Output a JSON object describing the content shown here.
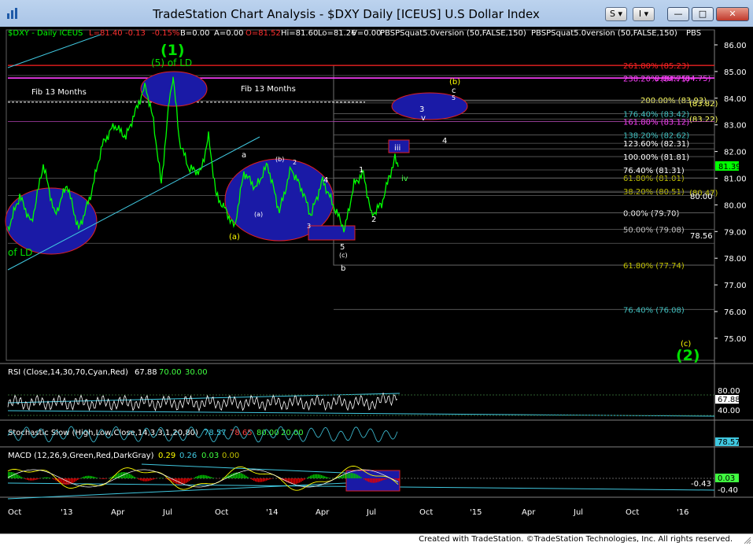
{
  "window": {
    "title": "TradeStation Chart Analysis - $DXY Daily [ICEUS] U.S Dollar Index",
    "dropdown_s": "S",
    "dropdown_i": "I",
    "minimize_label": "—",
    "maximize_label": "□",
    "close_label": "✕"
  },
  "footer": {
    "credit": "Created with TradeStation. ©TradeStation Technologies, Inc. All rights reserved."
  },
  "colors": {
    "background": "#000000",
    "price": "#00ff00",
    "fib_red": "#ff0000",
    "fib_magenta": "#ff00ff",
    "ellipse_fill": "#1a1aa6",
    "trendline": "#40c8e0",
    "wave_label": "#ffff00"
  },
  "header": {
    "symbol": "$DXY - Daily  ICEUS",
    "last": "L=81.40",
    "net": "-0.13",
    "pct": "-0.15%",
    "bid": "B=0.00",
    "ask": "A=0.00",
    "open": "O=81.52",
    "hi": "Hi=81.60",
    "lo": "Lo=81.26",
    "v": "V=0.00",
    "study1": "PBSPSquat5.0version (50,FALSE,150)",
    "study2": "PBSPSquat5.0version (50,FALSE,150)",
    "pbs": "PBS"
  },
  "price_axis": [
    "86.00",
    "85.00",
    "84.00",
    "83.00",
    "82.00",
    "81.00",
    "80.00",
    "79.00",
    "78.00",
    "77.00",
    "76.00",
    "75.00"
  ],
  "last_price_tag": "81.39",
  "price_tags": [
    "80.00",
    "78.56"
  ],
  "fib_levels": [
    {
      "label": "261.80% (85.23)",
      "price": 85.23,
      "color": "#ff2020"
    },
    {
      "label": "238.20% (84.75)",
      "price": 84.75,
      "color": "#ff40ff"
    },
    {
      "label": "0.00% (84.75)",
      "price": 84.76,
      "color": "#ff40ff"
    },
    {
      "label": "200.00% (83.93)",
      "price": 83.93,
      "color": "#ffff60"
    },
    {
      "label": "(83.82)",
      "price": 83.82,
      "color": "#ffff60"
    },
    {
      "label": "176.40% (83.42)",
      "price": 83.42,
      "color": "#40c0c0"
    },
    {
      "label": "161.80% (83.12)",
      "price": 83.12,
      "color": "#ff40ff"
    },
    {
      "label": "(83.22)",
      "price": 83.22,
      "color": "#ffff60"
    },
    {
      "label": "138.20% (82.62)",
      "price": 82.62,
      "color": "#40c0c0"
    },
    {
      "label": "123.60% (82.31)",
      "price": 82.31,
      "color": "#ffffff"
    },
    {
      "label": "100.00% (81.81)",
      "price": 81.81,
      "color": "#ffffff"
    },
    {
      "label": "76.40% (81.31)",
      "price": 81.31,
      "color": "#ffffff"
    },
    {
      "label": "61.80% (81.01)",
      "price": 81.01,
      "color": "#c0c000"
    },
    {
      "label": "38.20% (80.51)",
      "price": 80.51,
      "color": "#c0c000"
    },
    {
      "label": "(80.47)",
      "price": 80.47,
      "color": "#c0c000"
    },
    {
      "label": "0.00% (79.70)",
      "price": 79.7,
      "color": "#ffffff"
    },
    {
      "label": "50.00% (79.08)",
      "price": 79.08,
      "color": "#c0c0c0"
    },
    {
      "label": "61.80% (77.74)",
      "price": 77.74,
      "color": "#c0c000"
    },
    {
      "label": "76.40% (76.08)",
      "price": 76.08,
      "color": "#40c0c0"
    }
  ],
  "wave_labels": {
    "w1": "(1)",
    "w5_of_ld": "(5) of LD",
    "of_ld": "of LD",
    "fib13a": "Fib 13 Months",
    "fib13b": "Fib 13 Months",
    "a": "a",
    "b": "b",
    "wa": "(a)",
    "wa2": "(a)",
    "wb": "(b)",
    "wb_top": "(b)",
    "w2_small": "2",
    "w3_small": "3",
    "w4_small": "4",
    "w5_small": "5",
    "wc": "(c)",
    "n1": "1",
    "n2": "2",
    "n3": "3",
    "n4": "4",
    "iii": "iii",
    "iv": "iv",
    "v": "v",
    "c": "c",
    "c5": "5",
    "wc2": "(c)",
    "w2_big": "(2)"
  },
  "rsi": {
    "label": "RSI (Close,14,30,70,Cyan,Red)",
    "value": "67.88",
    "ob": "70.00",
    "os": "30.00",
    "axis_hi": "80.00",
    "axis_lo": "40.00",
    "tag": "67.88"
  },
  "stoch": {
    "label": "Stochastic Slow (High,Low,Close,14,3,3,1,20,80)",
    "k": "78.57",
    "d": "78.65",
    "ob": "80.00",
    "os": "20.00",
    "tag": "78.57"
  },
  "macd": {
    "label": "MACD (12,26,9,Green,Red,DarkGray)",
    "macd": "0.29",
    "signal": "0.26",
    "hist": "0.03",
    "zero": "0.00",
    "tag_a": "-0.43",
    "tag_b": "-0.40",
    "tag_c": "0.03"
  },
  "time_axis": [
    "Oct",
    "'13",
    "Apr",
    "Jul",
    "Oct",
    "'14",
    "Apr",
    "Jul",
    "Oct",
    "'15",
    "Apr",
    "Jul",
    "Oct",
    "'16"
  ]
}
